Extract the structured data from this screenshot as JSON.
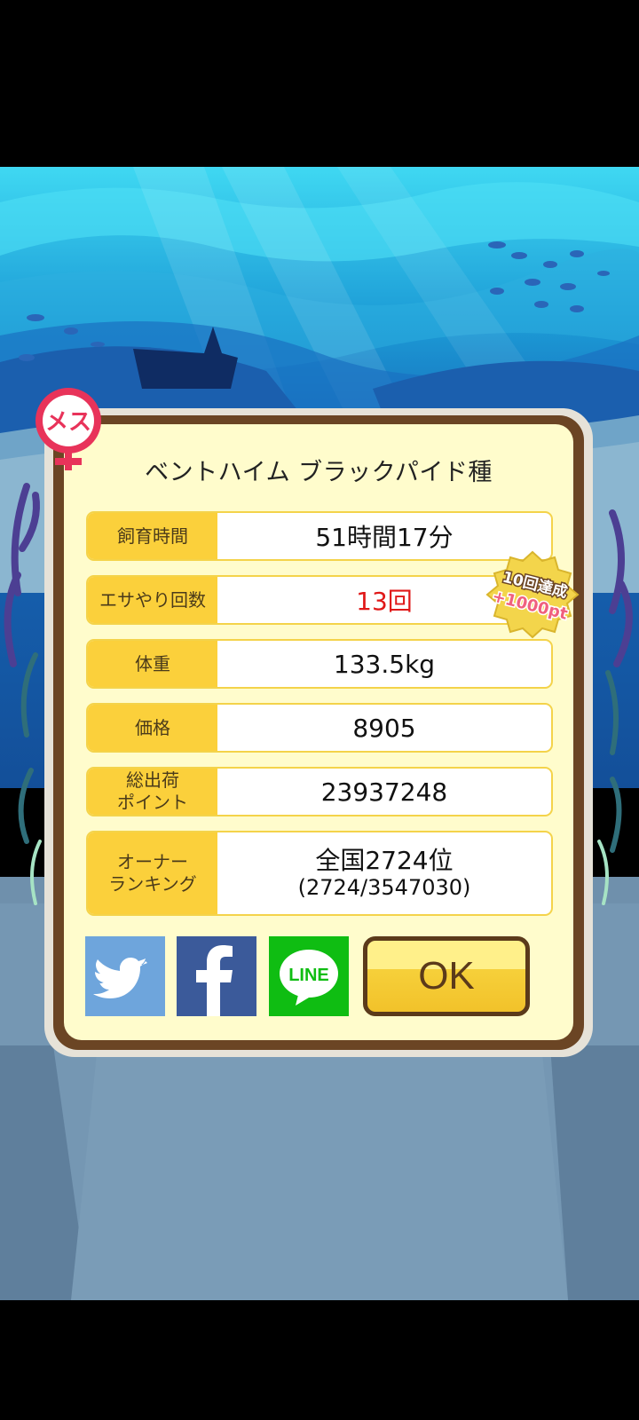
{
  "colors": {
    "dialog_frame": "#6b4524",
    "dialog_bg": "#fffccc",
    "label_bg": "#fbd03b",
    "highlight_value": "#e01818",
    "twitter": "#6ea5dc",
    "facebook": "#3b5a9a",
    "line": "#0fbd12"
  },
  "sex_badge": {
    "label": "メス",
    "icon": "female-symbol-icon"
  },
  "fish_name": "ベントハイム ブラックパイド種",
  "stats": [
    {
      "label": "飼育時間",
      "value": "51時間17分"
    },
    {
      "label": "エサやり回数",
      "value": "13回",
      "highlight": true
    },
    {
      "label": "体重",
      "value": "133.5kg"
    },
    {
      "label": "価格",
      "value": "8905"
    },
    {
      "label": "総出荷\nポイント",
      "value": "23937248"
    },
    {
      "label": "オーナー\nランキング",
      "value": "全国2724位",
      "sub": "(2724/3547030)"
    }
  ],
  "achievement_badge": {
    "line1": "10回達成",
    "line2": "+1000pt"
  },
  "share": {
    "twitter_icon": "twitter-bird-icon",
    "facebook_icon": "facebook-f-icon",
    "line_label": "LINE"
  },
  "ok_label": "OK"
}
